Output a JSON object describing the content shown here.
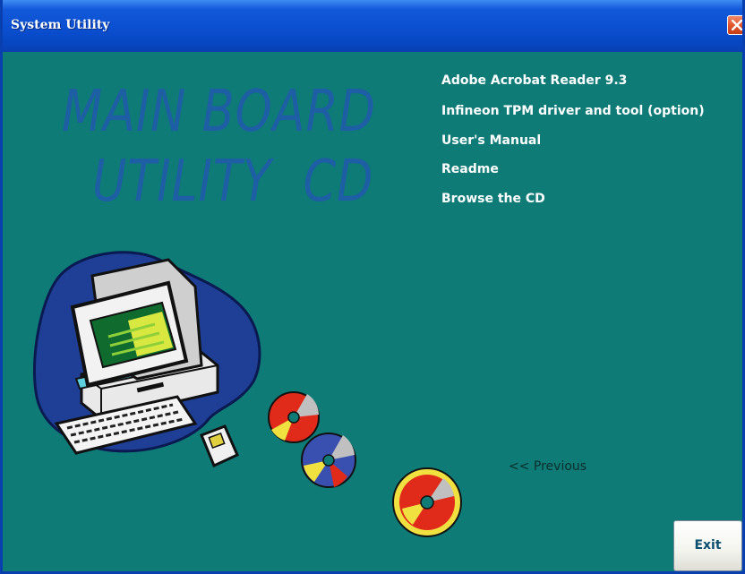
{
  "window": {
    "title": "System Utility"
  },
  "banner": {
    "line1": "MAIN BOARD",
    "line2": "UTILITY  CD"
  },
  "menu": {
    "items": [
      "Adobe Acrobat Reader 9.3",
      "Infineon TPM driver and tool (option)",
      "User's Manual",
      "Readme",
      "Browse the CD"
    ]
  },
  "navigation": {
    "previous_label": "<< Previous",
    "exit_label": "Exit"
  },
  "colors": {
    "background": "#0e7b77",
    "titlebar": "#0a4fd0",
    "banner_text": "#1d5ea4",
    "link_text": "#ffffff"
  },
  "icons": [
    "close-icon",
    "computer-illustration",
    "cd-disc-icon"
  ]
}
